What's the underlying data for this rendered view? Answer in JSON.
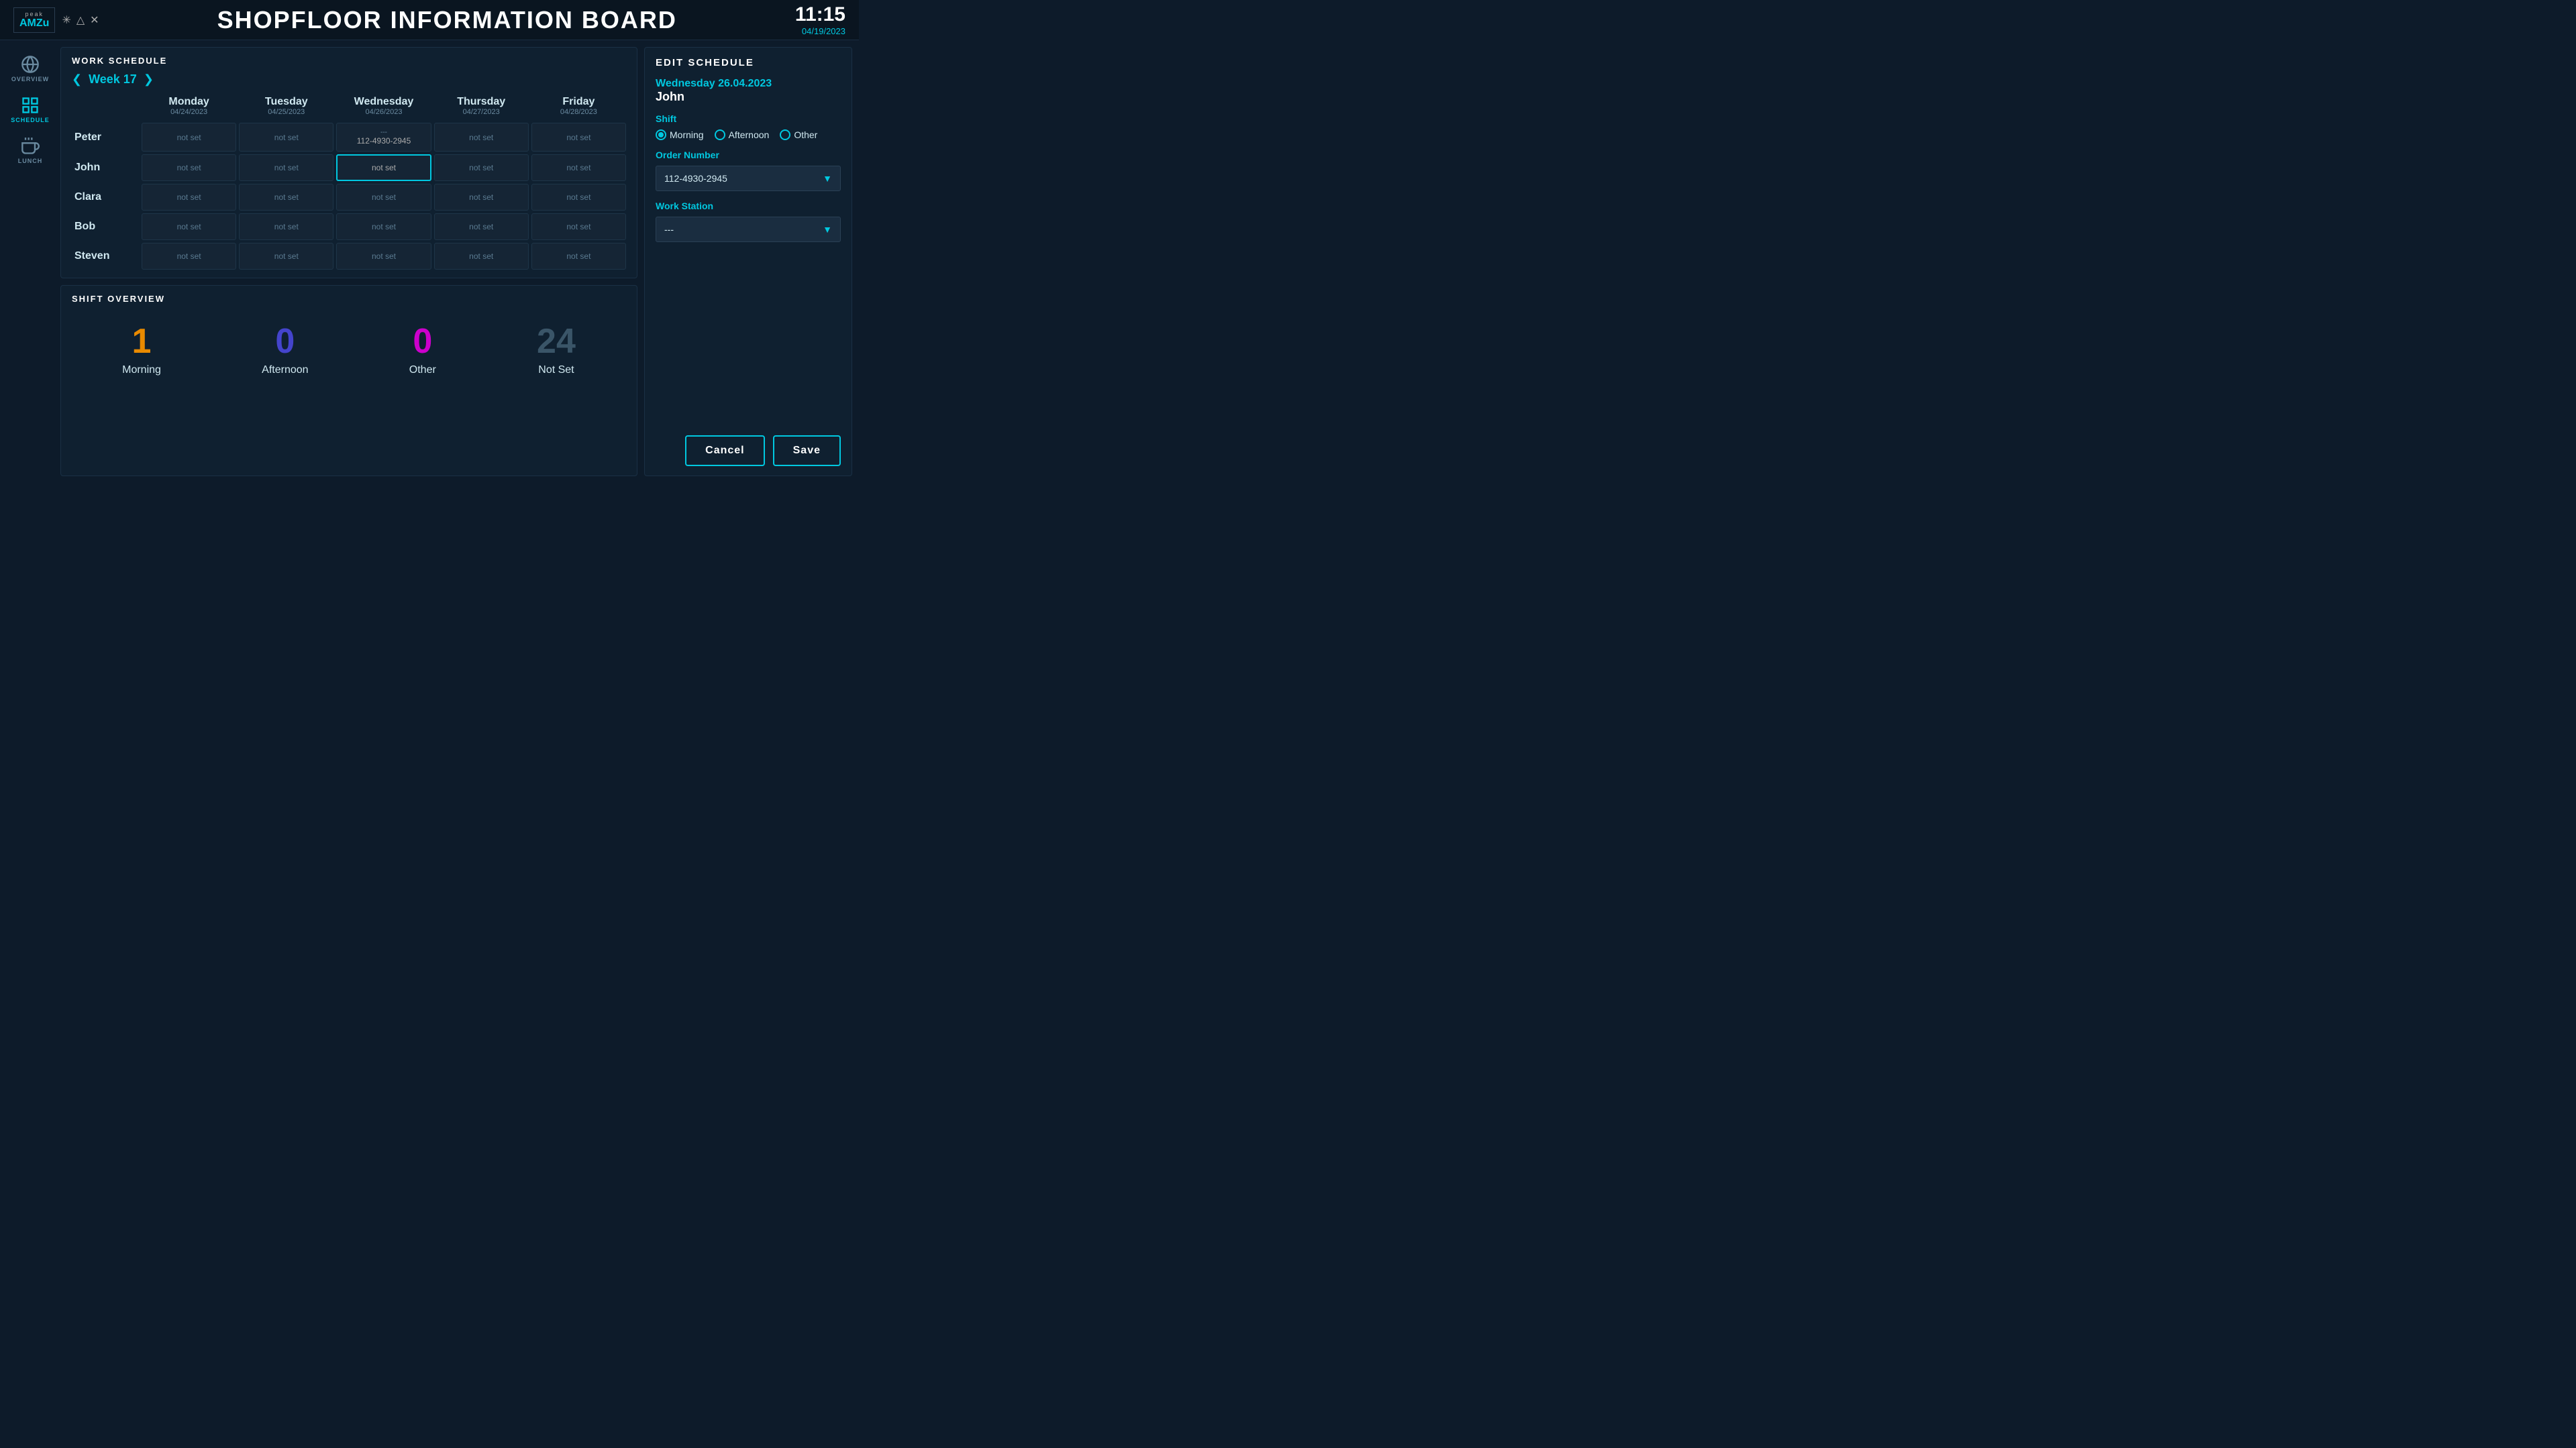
{
  "header": {
    "logo_top": "peak",
    "logo_bottom": "AMZu",
    "title": "SHOPFLOOR INFORMATION BOARD",
    "time": "11:15",
    "date": "04/19/2023"
  },
  "sidebar": {
    "items": [
      {
        "id": "overview",
        "label": "OVERVIEW",
        "active": false
      },
      {
        "id": "schedule",
        "label": "SCHEDULE",
        "active": true
      },
      {
        "id": "lunch",
        "label": "LUNCH",
        "active": false
      }
    ]
  },
  "work_schedule": {
    "title": "WORK SCHEDULE",
    "week_label": "Week 17",
    "columns": [
      {
        "day": "Monday",
        "date": "04/24/2023"
      },
      {
        "day": "Tuesday",
        "date": "04/25/2023"
      },
      {
        "day": "Wednesday",
        "date": "04/26/2023"
      },
      {
        "day": "Thursday",
        "date": "04/27/2023"
      },
      {
        "day": "Friday",
        "date": "04/28/2023"
      }
    ],
    "rows": [
      {
        "name": "Peter",
        "cells": [
          {
            "value": "not set",
            "type": "empty"
          },
          {
            "value": "not set",
            "type": "empty"
          },
          {
            "value": "112-4930-2945",
            "type": "data",
            "sub": "---"
          },
          {
            "value": "not set",
            "type": "empty"
          },
          {
            "value": "not set",
            "type": "empty"
          }
        ]
      },
      {
        "name": "John",
        "cells": [
          {
            "value": "not set",
            "type": "empty"
          },
          {
            "value": "not set",
            "type": "empty"
          },
          {
            "value": "not set",
            "type": "selected"
          },
          {
            "value": "not set",
            "type": "empty"
          },
          {
            "value": "not set",
            "type": "empty"
          }
        ]
      },
      {
        "name": "Clara",
        "cells": [
          {
            "value": "not set",
            "type": "empty"
          },
          {
            "value": "not set",
            "type": "empty"
          },
          {
            "value": "not set",
            "type": "empty"
          },
          {
            "value": "not set",
            "type": "empty"
          },
          {
            "value": "not set",
            "type": "empty"
          }
        ]
      },
      {
        "name": "Bob",
        "cells": [
          {
            "value": "not set",
            "type": "empty"
          },
          {
            "value": "not set",
            "type": "empty"
          },
          {
            "value": "not set",
            "type": "empty"
          },
          {
            "value": "not set",
            "type": "empty"
          },
          {
            "value": "not set",
            "type": "empty"
          }
        ]
      },
      {
        "name": "Steven",
        "cells": [
          {
            "value": "not set",
            "type": "empty"
          },
          {
            "value": "not set",
            "type": "empty"
          },
          {
            "value": "not set",
            "type": "empty"
          },
          {
            "value": "not set",
            "type": "empty"
          },
          {
            "value": "not set",
            "type": "empty"
          }
        ]
      }
    ]
  },
  "shift_overview": {
    "title": "SHIFT OVERVIEW",
    "stats": [
      {
        "id": "morning",
        "value": "1",
        "label": "Morning",
        "color": "#e88a00"
      },
      {
        "id": "afternoon",
        "value": "0",
        "label": "Afternoon",
        "color": "#4444cc"
      },
      {
        "id": "other",
        "value": "0",
        "label": "Other",
        "color": "#cc00cc"
      },
      {
        "id": "notset",
        "value": "24",
        "label": "Not Set",
        "color": "#3a5568"
      }
    ]
  },
  "edit_schedule": {
    "title": "EDIT SCHEDULE",
    "date_label": "Wednesday   26.04.2023",
    "person": "John",
    "shift_label": "Shift",
    "shift_options": [
      {
        "id": "morning",
        "label": "Morning",
        "selected": true
      },
      {
        "id": "afternoon",
        "label": "Afternoon",
        "selected": false
      },
      {
        "id": "other",
        "label": "Other",
        "selected": false
      }
    ],
    "order_number_label": "Order Number",
    "order_number_value": "112-4930-2945",
    "workstation_label": "Work Station",
    "workstation_value": "---",
    "cancel_label": "Cancel",
    "save_label": "Save"
  }
}
